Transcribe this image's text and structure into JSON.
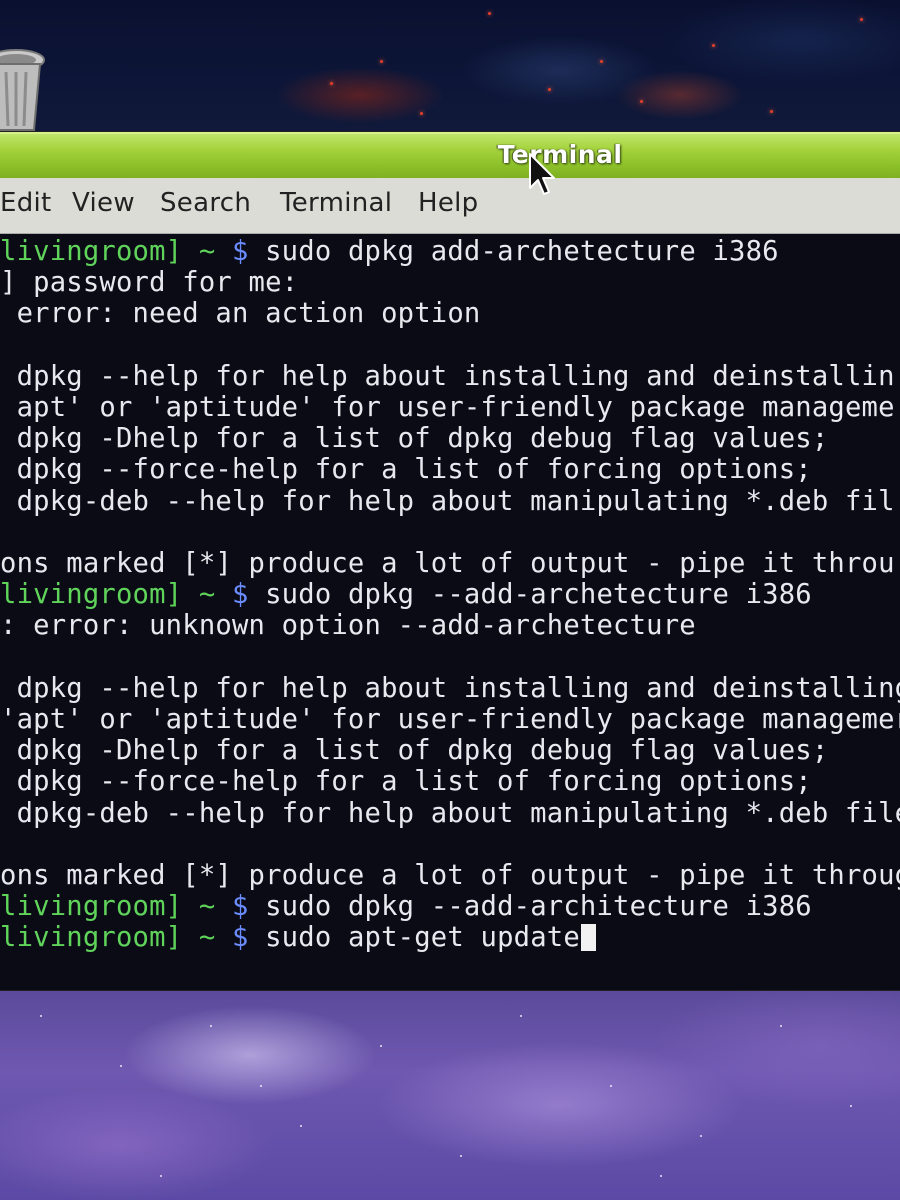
{
  "window": {
    "title": "Terminal"
  },
  "menu": {
    "items": [
      "Edit",
      "View",
      "Search",
      "Terminal",
      "Help"
    ]
  },
  "terminal": {
    "lines": [
      {
        "prompt": "livingroom] ~ ",
        "symbol": "$",
        "text": " sudo dpkg add-archetecture i386"
      },
      {
        "text": "] password for me:"
      },
      {
        "text": " error: need an action option"
      },
      {
        "text": ""
      },
      {
        "text": " dpkg --help for help about installing and deinstallin"
      },
      {
        "text": " apt' or 'aptitude' for user-friendly package manageme"
      },
      {
        "text": " dpkg -Dhelp for a list of dpkg debug flag values;"
      },
      {
        "text": " dpkg --force-help for a list of forcing options;"
      },
      {
        "text": " dpkg-deb --help for help about manipulating *.deb fil"
      },
      {
        "text": ""
      },
      {
        "text": "ons marked [*] produce a lot of output - pipe it throu"
      },
      {
        "prompt": "livingroom] ~ ",
        "symbol": "$",
        "text": " sudo dpkg --add-archetecture i386"
      },
      {
        "text": ": error: unknown option --add-archetecture"
      },
      {
        "text": ""
      },
      {
        "text": " dpkg --help for help about installing and deinstalling"
      },
      {
        "text": "'apt' or 'aptitude' for user-friendly package managemer"
      },
      {
        "text": " dpkg -Dhelp for a list of dpkg debug flag values;"
      },
      {
        "text": " dpkg --force-help for a list of forcing options;"
      },
      {
        "text": " dpkg-deb --help for help about manipulating *.deb file"
      },
      {
        "text": ""
      },
      {
        "text": "ons marked [*] produce a lot of output - pipe it throug"
      },
      {
        "prompt": "livingroom] ~ ",
        "symbol": "$",
        "text": " sudo dpkg --add-architecture i386"
      },
      {
        "prompt": "livingroom] ~ ",
        "symbol": "$",
        "text": " sudo apt-get update",
        "cursor": true
      }
    ]
  },
  "colors": {
    "titlebar": "#a4d23c",
    "prompt_user": "#5fd35a",
    "prompt_symbol": "#6b8cff",
    "terminal_bg": "#0b0b16",
    "terminal_fg": "#e8e8ee"
  },
  "icons": {
    "desktop": "trash-icon",
    "pointer": "mouse-pointer-icon"
  }
}
